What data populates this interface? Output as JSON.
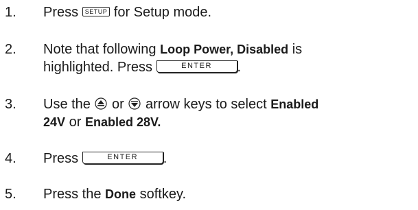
{
  "steps": [
    {
      "num": "1.",
      "pre": "Press ",
      "key": "SETUP",
      "post": " for Setup mode."
    },
    {
      "num": "2.",
      "line1_pre": "Note that following ",
      "line1_bold": "Loop Power, Disabled",
      "line1_post": " is",
      "line2_pre": "highlighted. Press ",
      "key": "ENTER",
      "line2_post": "."
    },
    {
      "num": "3.",
      "line1_pre": "Use the ",
      "line1_mid": " or ",
      "line1_mid2": " arrow keys to select ",
      "line1_bold": "Enabled",
      "line2_bold1": "24V",
      "line2_mid": " or ",
      "line2_bold2": "Enabled 28V."
    },
    {
      "num": "4.",
      "pre": "Press ",
      "key": "ENTER",
      "post": "."
    },
    {
      "num": "5.",
      "pre": "Press the ",
      "bold": "Done",
      "post": " softkey."
    }
  ],
  "icons": {
    "up": "up-arrow-key-icon",
    "down": "down-arrow-key-icon"
  }
}
